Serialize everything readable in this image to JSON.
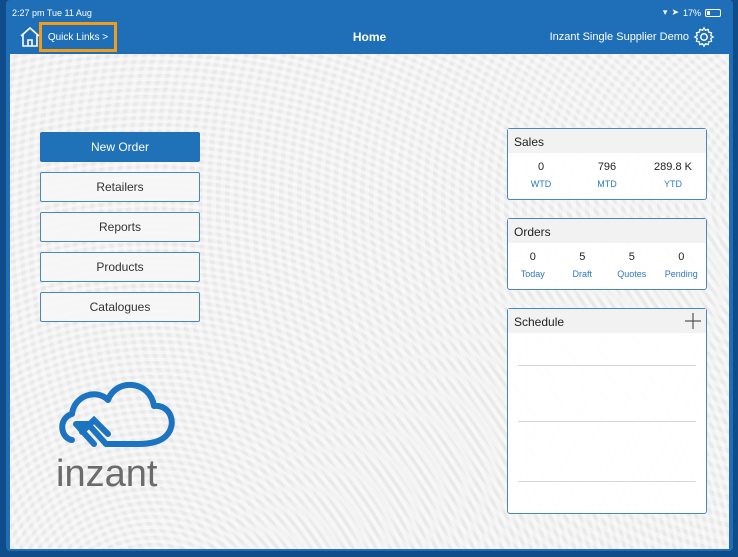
{
  "status": {
    "time": "2:27 pm  Tue 11 Aug",
    "battery": "17%"
  },
  "nav": {
    "quick_links": "Quick Links >",
    "title": "Home",
    "supplier": "Inzant Single Supplier Demo"
  },
  "menu": {
    "new_order": "New Order",
    "retailers": "Retailers",
    "reports": "Reports",
    "products": "Products",
    "catalogues": "Catalogues"
  },
  "logo_text": "inzant",
  "sales": {
    "title": "Sales",
    "stats": [
      {
        "value": "0",
        "label": "WTD"
      },
      {
        "value": "796",
        "label": "MTD"
      },
      {
        "value": "289.8 K",
        "label": "YTD"
      }
    ]
  },
  "orders": {
    "title": "Orders",
    "stats": [
      {
        "value": "0",
        "label": "Today"
      },
      {
        "value": "5",
        "label": "Draft"
      },
      {
        "value": "5",
        "label": "Quotes"
      },
      {
        "value": "0",
        "label": "Pending"
      }
    ]
  },
  "schedule": {
    "title": "Schedule"
  },
  "colors": {
    "brand": "#1f72b8",
    "highlight": "#f39c1a",
    "accent_text": "#2a78c3"
  }
}
